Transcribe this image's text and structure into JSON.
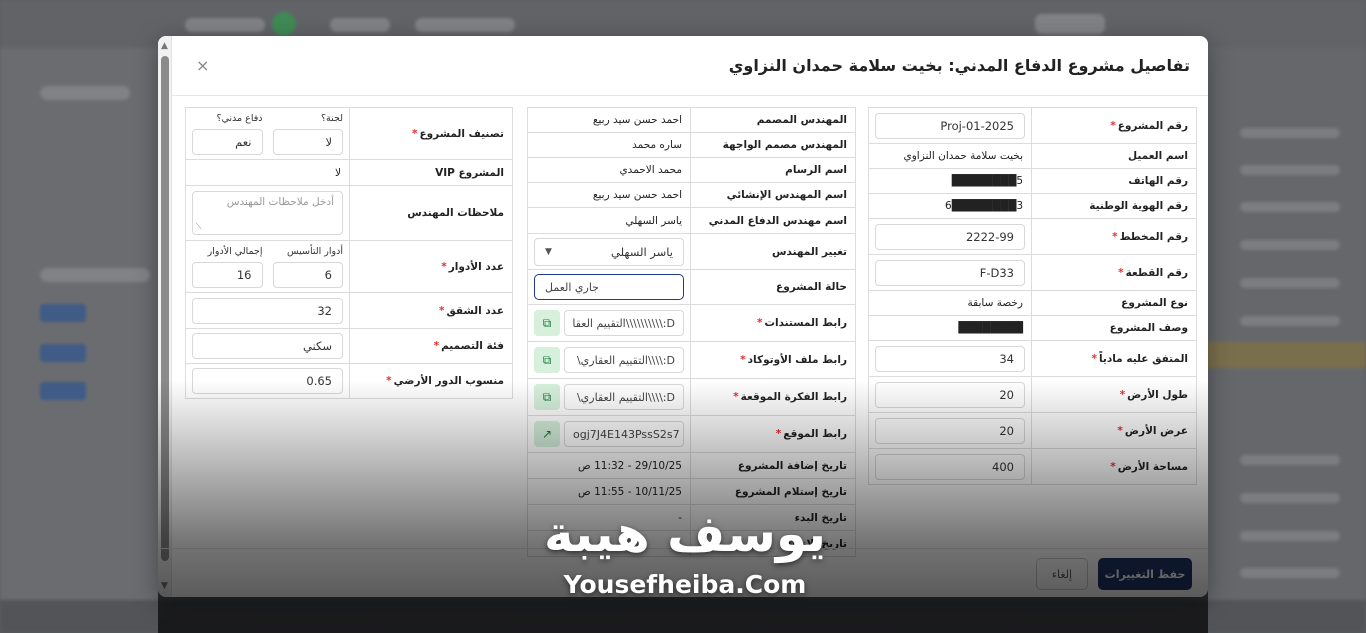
{
  "modal": {
    "title": "تفاصيل مشروع الدفاع المدني: بخيت سلامة حمدان النزاوي",
    "close": "×"
  },
  "right_table": [
    {
      "label": "رقم المشروع",
      "required": true,
      "value": "Proj-01-2025",
      "input": true
    },
    {
      "label": "اسم العميل",
      "required": false,
      "value": "بخيت سلامة حمدان النزاوي",
      "input": false
    },
    {
      "label": "رقم الهاتف",
      "required": false,
      "value": "5████████",
      "input": false
    },
    {
      "label": "رقم الهوية الوطنية",
      "required": false,
      "value": "3████████6",
      "input": false
    },
    {
      "label": "رقم المخطط",
      "required": true,
      "value": "2222-99",
      "input": true
    },
    {
      "label": "رقم القطعة",
      "required": true,
      "value": "F-D33",
      "input": true
    },
    {
      "label": "نوع المشروع",
      "required": false,
      "value": "رخصة سابقة",
      "input": false
    },
    {
      "label": "وصف المشروع",
      "required": false,
      "value": "████████",
      "input": false
    },
    {
      "label": "المتفق عليه مادياً",
      "required": true,
      "value": "34",
      "input": true
    },
    {
      "label": "طول الأرض",
      "required": true,
      "value": "20",
      "input": true
    },
    {
      "label": "عرض الأرض",
      "required": true,
      "value": "20",
      "input": true
    },
    {
      "label": "مساحة الأرض",
      "required": true,
      "value": "400",
      "input": true
    }
  ],
  "middle_table": {
    "rows": [
      {
        "label": "المهندس المصمم",
        "value": "احمد حسن سيد ربيع"
      },
      {
        "label": "المهندس مصمم الواجهة",
        "value": "ساره محمد"
      },
      {
        "label": "اسم الرسام",
        "value": "محمد الاحمدي"
      },
      {
        "label": "اسم المهندس الإنشائي",
        "value": "احمد حسن سيد ربيع"
      },
      {
        "label": "اسم مهندس الدفاع المدني",
        "value": "ياسر السهلي"
      }
    ],
    "change_engineer": {
      "label": "تغيير المهندس",
      "value": "ياسر السهلي"
    },
    "project_status": {
      "label": "حالة المشروع",
      "value": "جاري العمل"
    },
    "links": [
      {
        "label": "رابط المستندات",
        "value": "D:\\\\\\\\\\\\\\\\\\\\التقييم العقا",
        "icon": "copy-icon",
        "icon_glyph": "⧉"
      },
      {
        "label": "رابط ملف الأوتوكاد",
        "value": "D:\\\\\\\\التقييم العقاري\\",
        "icon": "copy-icon",
        "icon_glyph": "⧉"
      },
      {
        "label": "رابط الفكرة الموقعة",
        "value": "D:\\\\\\\\التقييم العقاري\\",
        "icon": "copy-icon",
        "icon_glyph": "⧉"
      },
      {
        "label": "رابط الموقع",
        "value": "ogj7J4E143PssS2s7",
        "icon": "external-link-icon",
        "icon_glyph": "↗"
      }
    ],
    "dates": [
      {
        "label": "تاريخ إضافة المشروع",
        "value": "29/10/25 - 11:32 ص"
      },
      {
        "label": "تاريخ إستلام المشروع",
        "value": "10/11/25 - 11:55 ص"
      },
      {
        "label": "تاريخ البدء",
        "value": "-"
      },
      {
        "label": "تاريخ الانتهاء",
        "value": ""
      }
    ]
  },
  "left_table": {
    "classification": {
      "label": "تصنيف المشروع",
      "committee_label": "لجنة؟",
      "committee_value": "لا",
      "civil_label": "دفاع مدني؟",
      "civil_value": "نعم"
    },
    "vip": {
      "label": "المشروع VIP",
      "value": "لا"
    },
    "notes": {
      "label": "ملاحظات المهندس",
      "placeholder": "أدخل ملاحظات المهندس"
    },
    "floors": {
      "label": "عدد الأدوار",
      "foundation_label": "أدوار التأسيس",
      "foundation_value": "6",
      "total_label": "إجمالي الأدوار",
      "total_value": "16"
    },
    "apartments": {
      "label": "عدد الشقق",
      "value": "32"
    },
    "design_category": {
      "label": "فئة التصميم",
      "value": "سكني"
    },
    "ground_level": {
      "label": "منسوب الدور الأرضي",
      "value": "0.65"
    }
  },
  "footer": {
    "save": "حفظ التغييرات",
    "cancel": "إلغاء"
  },
  "watermark": {
    "arabic": "يوسف هيبة",
    "english": "Yousefheiba.Com"
  }
}
